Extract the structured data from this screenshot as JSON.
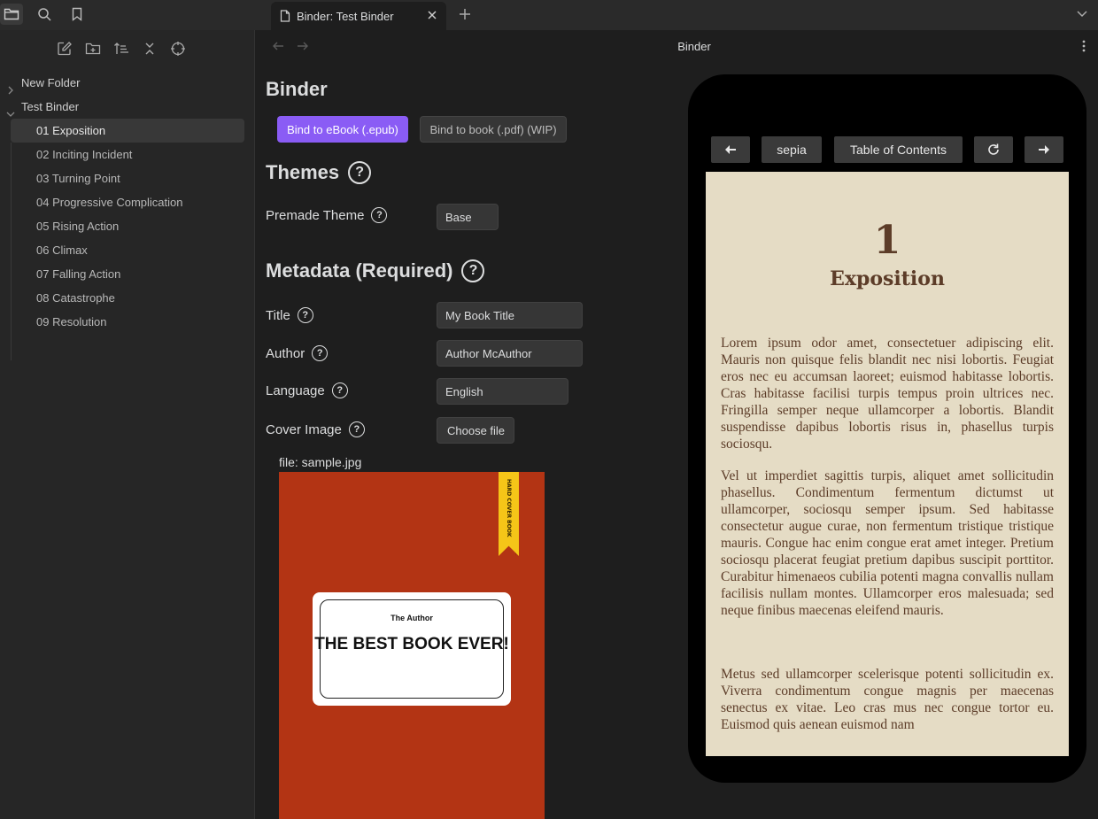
{
  "tab": {
    "title": "Binder: Test Binder"
  },
  "sidebar": {
    "folders": [
      {
        "label": "New Folder",
        "expanded": false
      },
      {
        "label": "Test Binder",
        "expanded": true
      }
    ],
    "files": [
      "01 Exposition",
      "02 Inciting Incident",
      "03 Turning Point",
      "04 Progressive Complication",
      "05 Rising Action",
      "06 Climax",
      "07 Falling Action",
      "08 Catastrophe",
      "09 Resolution"
    ],
    "active_file": "01 Exposition"
  },
  "main": {
    "header_title": "Binder",
    "heading": "Binder",
    "buttons": {
      "epub": "Bind to eBook (.epub)",
      "pdf": "Bind to book (.pdf) (WIP)"
    },
    "themes": {
      "heading": "Themes",
      "premade_label": "Premade Theme",
      "premade_value": "Base"
    },
    "metadata": {
      "heading": "Metadata (Required)",
      "title_label": "Title",
      "title_value": "My Book Title",
      "author_label": "Author",
      "author_value": "Author McAuthor",
      "language_label": "Language",
      "language_value": "English",
      "cover_label": "Cover Image",
      "cover_button": "Choose file",
      "file_caption": "file: sample.jpg"
    },
    "cover_image": {
      "ribbon_text": "HARD COVER BOOK",
      "author": "The Author",
      "title": "THE BEST BOOK EVER!"
    }
  },
  "preview": {
    "toolbar": {
      "theme": "sepia",
      "toc": "Table of Contents"
    },
    "chapter_number": "1",
    "chapter_title": "Exposition",
    "paragraphs": [
      "Lorem ipsum odor amet, consectetuer adipiscing elit. Mauris non quisque felis blandit nec nisi lobortis. Feugiat eros nec eu accumsan laoreet; euismod habitasse lobortis. Cras habitasse facilisi turpis tempus proin ultrices nec. Fringilla semper neque ullamcorper a lobortis. Blandit suspendisse dapibus lobortis risus in, phasellus turpis sociosqu.",
      "Vel ut imperdiet sagittis turpis, aliquet amet sollicitudin phasellus. Condimentum fermentum dictumst ut ullamcorper, sociosqu semper ipsum. Sed habitasse consectetur augue curae, non fermentum tristique tristique mauris. Congue hac enim congue erat amet integer. Pretium sociosqu placerat feugiat pretium dapibus suscipit porttitor. Curabitur himenaeos cubilia potenti magna convallis nullam facilisis nullam montes. Ullamcorper eros malesuada; sed neque finibus maecenas eleifend mauris.",
      "Metus sed ullamcorper scelerisque potenti sollicitudin ex. Viverra condimentum congue magnis per maecenas senectus ex vitae. Leo cras mus nec congue tortor eu. Euismod quis aenean euismod nam"
    ]
  },
  "colors": {
    "accent": "#8a5cf5",
    "sepia_bg": "#e5dcc5",
    "sepia_text": "#5c3c28",
    "cover_bg": "#b33414"
  }
}
